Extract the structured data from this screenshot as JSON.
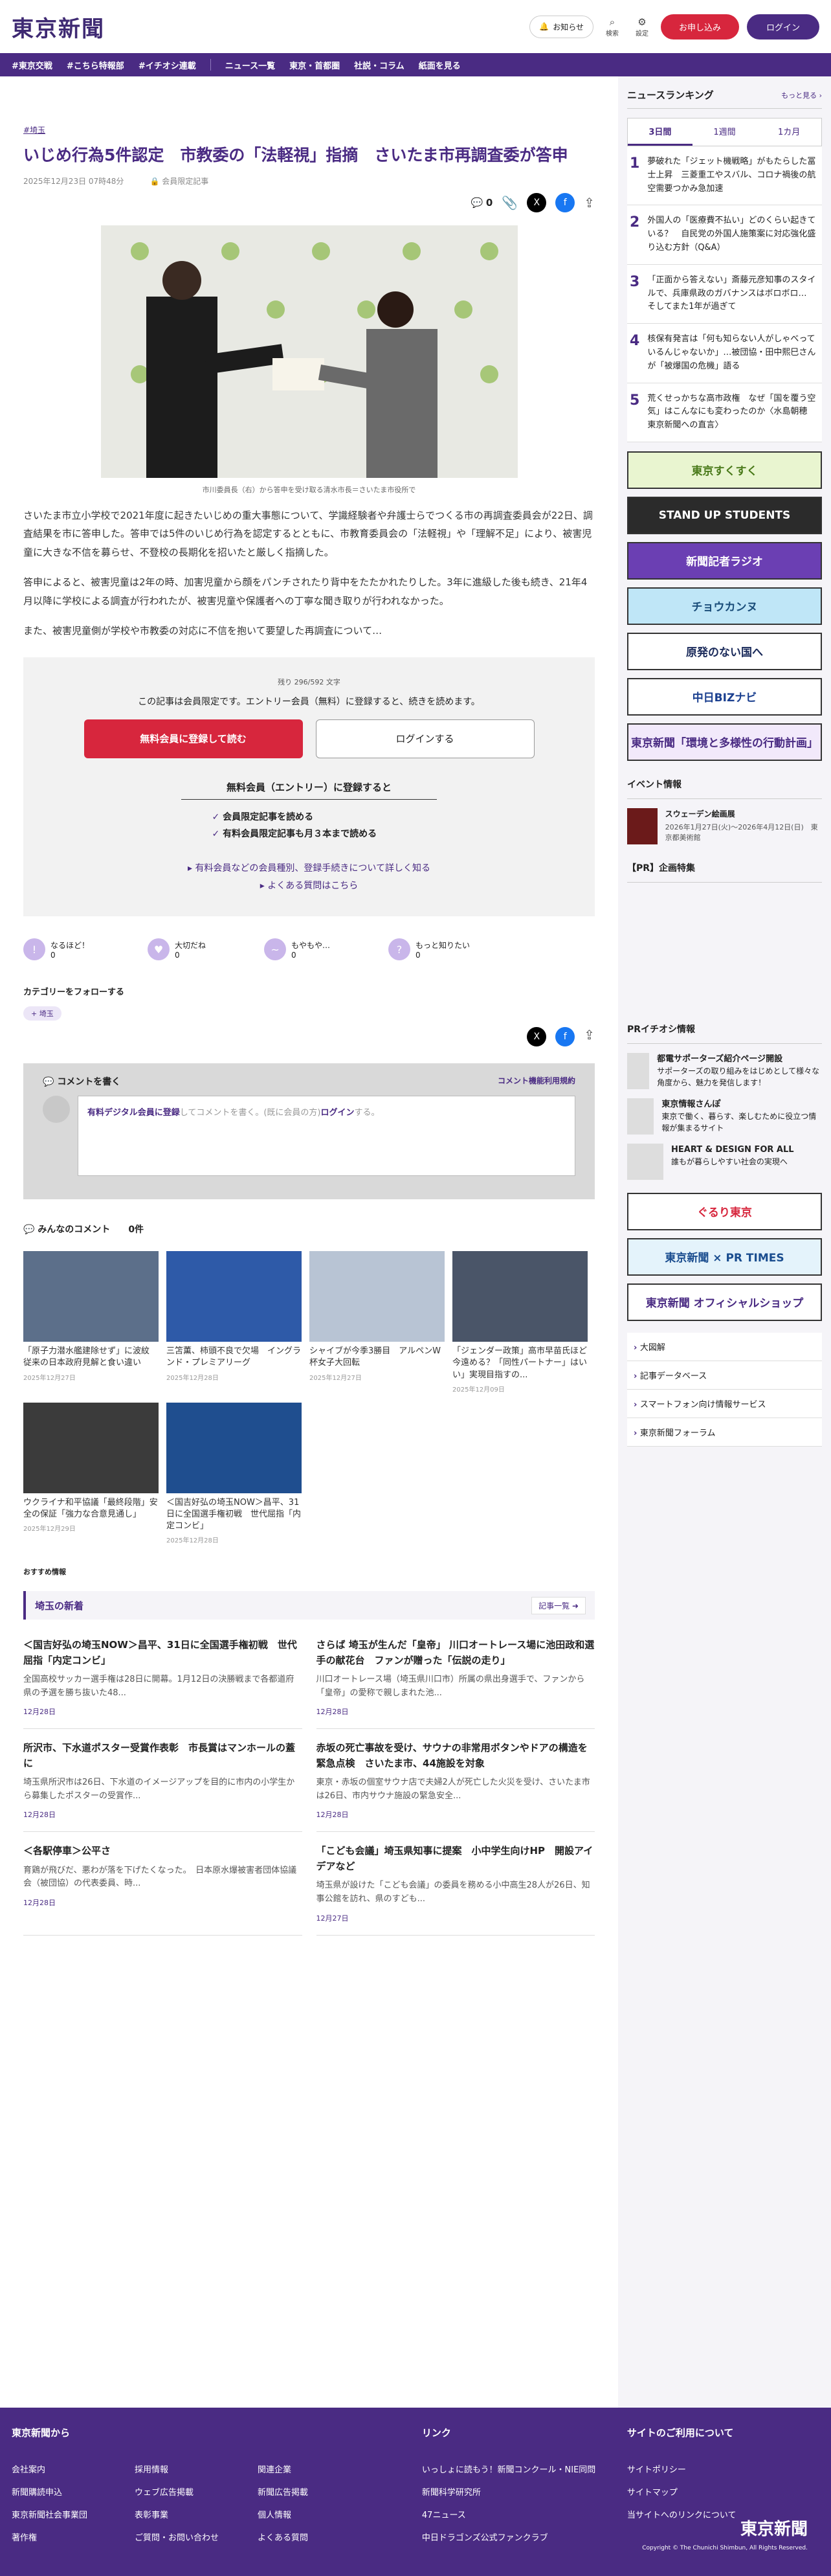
{
  "header": {
    "logo": "東京新聞",
    "notice": "お知らせ",
    "search": "検索",
    "settings": "設定",
    "register": "お申し込み",
    "login": "ログイン"
  },
  "nav": [
    "#東京交戦",
    "#こちら特報部",
    "#イチオシ連載",
    "ニュース一覧",
    "東京・首都圏",
    "社説・コラム",
    "紙面を見る"
  ],
  "article": {
    "breadcrumb": "#埼玉",
    "title": "いじめ行為5件認定　市教委の「法軽視」指摘　さいたま市再調査委が答申",
    "date": "2025年12月23日 07時48分",
    "badge": "会員限定記事",
    "comment_count": "0",
    "caption": "市川委員長（右）から答申を受け取る清水市長＝さいたま市役所で",
    "paragraphs": [
      "さいたま市立小学校で2021年度に起きたいじめの重大事態について、学識経験者や弁護士らでつくる市の再調査委員会が22日、調査結果を市に答申した。答申では5件のいじめ行為を認定するとともに、市教育委員会の「法軽視」や「理解不足」により、被害児童に大きな不信を募らせ、不登校の長期化を招いたと厳しく指摘した。",
      "答申によると、被害児童は2年の時、加害児童から顔をパンチされたり背中をたたかれたりした。3年に進級した後も続き、21年4月以降に学校による調査が行われたが、被害児童や保護者への丁寧な聞き取りが行われなかった。",
      "また、被害児童側が学校や市教委の対応に不信を抱いて要望した再調査について…"
    ]
  },
  "paywall": {
    "remaining": "残り 296/592 文字",
    "lead": "この記事は会員限定です。エントリー会員（無料）に登録すると、続きを読めます。",
    "free_button": "無料会員に登録して読む",
    "login_button": "ログインする",
    "benefit_title": "無料会員（エントリー）に登録すると",
    "benefits": [
      "会員限定記事を読める",
      "有料会員限定記事も月３本まで読める"
    ],
    "link1": "有料会員などの会員種別、登録手続きについて詳しく知る",
    "link2": "よくある質問はこちら"
  },
  "reactions": [
    {
      "label": "なるほど！",
      "count": "0",
      "icon": "!"
    },
    {
      "label": "大切だね",
      "count": "0",
      "icon": "♥"
    },
    {
      "label": "もやもや…",
      "count": "0",
      "icon": "~"
    },
    {
      "label": "もっと知りたい",
      "count": "0",
      "icon": "?"
    }
  ],
  "follow": {
    "label": "カテゴリーをフォローする",
    "tag": "埼玉"
  },
  "comment_box": {
    "title": "コメントを書く",
    "rules": "コメント機能利用規約",
    "placeholder_link": "有料デジタル会員に登録",
    "placeholder_rest": "してコメントを書く。(既に会員の方)",
    "login": "ログイン",
    "tail": "する。"
  },
  "comments": {
    "title": "みんなのコメント",
    "count": "0件"
  },
  "related": [
    {
      "title": "「原子力潜水艦建除せず」に波紋　従来の日本政府見解と食い違い",
      "date": "2025年12月27日",
      "color": "#5c6f8a"
    },
    {
      "title": "三笘薫、柿頭不良で欠場　イングランド・プレミアリーグ",
      "date": "2025年12月28日",
      "color": "#2e5aa8"
    },
    {
      "title": "シャイブが今季3勝目　アルペンW杯女子大回転",
      "date": "2025年12月27日",
      "color": "#b8c4d4"
    },
    {
      "title": "「ジェンダー政策」高市早苗氏ほど今遠める？「同性パートナー」はいい」実現目指すの...",
      "date": "2025年12月09日",
      "color": "#4a5568"
    },
    {
      "title": "ウクライナ和平協議「最終段階」安全の保証「強力な合意見通し」",
      "date": "2025年12月29日",
      "color": "#3b3b3b"
    },
    {
      "title": "＜国吉好弘の埼玉NOW＞昌平、31日に全国選手権初戦　世代屈指「内定コンビ」",
      "date": "2025年12月28日",
      "color": "#1f4e8f"
    }
  ],
  "recommend": "おすすめ情報",
  "local": {
    "title": "埼玉の新着",
    "more": "記事一覧",
    "items": [
      {
        "title": "＜国吉好弘の埼玉NOW＞昌平、31日に全国選手権初戦　世代屈指「内定コンビ」",
        "summary": "全国高校サッカー選手権は28日に開幕。1月12日の決勝戦まで各都道府県の予選を勝ち抜いた48...",
        "date": "12月28日"
      },
      {
        "title": "さらば 埼玉が生んだ「皇帝」 川口オートレース場に池田政和選手の献花台　ファンが贈った「伝説の走り」",
        "summary": "川口オートレース場（埼玉県川口市）所属の県出身選手で、ファンから「皇帝」の愛称で親しまれた池...",
        "date": "12月28日"
      },
      {
        "title": "所沢市、下水道ポスター受賞作表彰　市長賞はマンホールの蓋に",
        "summary": "埼玉県所沢市は26日、下水道のイメージアップを目的に市内の小学生から募集したポスターの受賞作...",
        "date": "12月28日"
      },
      {
        "title": "赤坂の死亡事故を受け、サウナの非常用ボタンやドアの構造を緊急点検　さいたま市、44施設を対象",
        "summary": "東京・赤坂の個室サウナ店で夫婦2人が死亡した火災を受け、さいたま市は26日、市内サウナ施設の緊急安全...",
        "date": "12月28日"
      },
      {
        "title": "＜各駅停車＞公平さ",
        "summary": "育鶏が飛びだ、悪わが落を下げたくなった。　日本原水爆被害者団体協議会（被団協）の代表委員、時...",
        "date": "12月28日"
      },
      {
        "title": "「こども会議」埼玉県知事に提案　小中学生向けHP　開設アイデアなど",
        "summary": "埼玉県が設けた「こども会議」の委員を務める小中高生28人が26日、知事公館を訪れ、県のすども...",
        "date": "12月27日"
      }
    ]
  },
  "sidebar": {
    "ranking_title": "ニュースランキング",
    "ranking_more": "もっと見る",
    "tabs": [
      "3日間",
      "1週間",
      "1カ月"
    ],
    "ranking": [
      {
        "n": "1",
        "title": "夢破れた「ジェット機戦略」がもたらした冨士上昇　三菱重工やスバル、コロナ禍後の航空需要つかみ急加速"
      },
      {
        "n": "2",
        "title": "外国人の「医療費不払い」どのくらい起きている？　自民党の外国人施策案に対応強化盛り込む方針（Q&A）"
      },
      {
        "n": "3",
        "title": "「正面から答えない」斎藤元彦知事のスタイルで、兵庫県政のガバナンスはボロボロ…　そしてまた1年が過ぎて"
      },
      {
        "n": "4",
        "title": "核保有発言は「何も知らない人がしゃべっているんじゃないか」…被団協・田中熙巳さんが「被爆国の危機」語る"
      },
      {
        "n": "5",
        "title": "荒くせっかちな高市政権　なぜ「国を覆う空気」はこんなにも変わったのか〈水島朝穂 東京新聞への直言〉"
      }
    ],
    "banners": [
      {
        "label": "東京すくすく",
        "bg": "#e9f5d0",
        "fg": "#4a7a1a"
      },
      {
        "label": "STAND UP STUDENTS",
        "bg": "#2b2b2b",
        "fg": "#fff"
      },
      {
        "label": "新聞記者ラジオ",
        "bg": "#6b3fb3",
        "fg": "#fff"
      },
      {
        "label": "チョウカンヌ",
        "bg": "#bfe6f7",
        "fg": "#1a4d7a"
      },
      {
        "label": "原発のない国へ",
        "bg": "#fff",
        "fg": "#1a2a5a"
      },
      {
        "label": "中日BIZナビ",
        "bg": "#fff",
        "fg": "#1a3f8f"
      },
      {
        "label": "東京新聞「環境と多様性の行動計画」",
        "bg": "#f2e9fb",
        "fg": "#4a2b83"
      }
    ],
    "event_title": "イベント情報",
    "event": {
      "title": "スウェーデン絵画展",
      "period": "2026年1月27日(火)～2026年4月12日(日)　東京都美術館"
    },
    "pr_title": "【PR】企画特集",
    "pr2_title": "PRイチオシ情報",
    "pr": [
      {
        "title": "都電サポーターズ紹介ページ開設",
        "desc": "サポーターズの取り組みをはじめとして様々な角度から、魅力を発信します！"
      },
      {
        "title": "東京情報さんぽ",
        "desc": "東京で働く、暮らす、楽しむために役立つ情報が集まるサイト"
      },
      {
        "title": "HEART & DESIGN FOR ALL",
        "desc": "誰もが暮らしやすい社会の実現へ"
      }
    ],
    "banners2": [
      {
        "label": "ぐるり東京",
        "bg": "#fff",
        "fg": "#d7263d"
      },
      {
        "label": "東京新聞 × PR TIMES",
        "bg": "#e4f3fb",
        "fg": "#1a4d8f"
      },
      {
        "label": "東京新聞 オフィシャルショップ",
        "bg": "#fff",
        "fg": "#4a2b83"
      }
    ],
    "links": [
      "大図解",
      "記事データベース",
      "スマートフォン向け情報サービス",
      "東京新聞フォーラム"
    ]
  },
  "footer": {
    "col1_title": "東京新聞から",
    "col1": [
      "会社案内",
      "採用情報",
      "関連企業",
      "新聞購読申込",
      "ウェブ広告掲載",
      "新聞広告掲載",
      "東京新聞社会事業団",
      "表彰事業",
      "個人情報",
      "著作権",
      "ご質問・お問い合わせ",
      "よくある質問"
    ],
    "col2_title": "リンク",
    "col2": [
      "いっしょに読もう！新聞コンクール・NIE同問",
      "新聞科学研究所",
      "47ニュース",
      "中日ドラゴンズ公式ファンクラブ"
    ],
    "col3_title": "サイトのご利用について",
    "col3": [
      "サイトポリシー",
      "サイトマップ",
      "当サイトへのリンクについて"
    ],
    "logo": "東京新聞",
    "copyright": "Copyright © The Chunichi Shimbun, All Rights Reserved."
  }
}
